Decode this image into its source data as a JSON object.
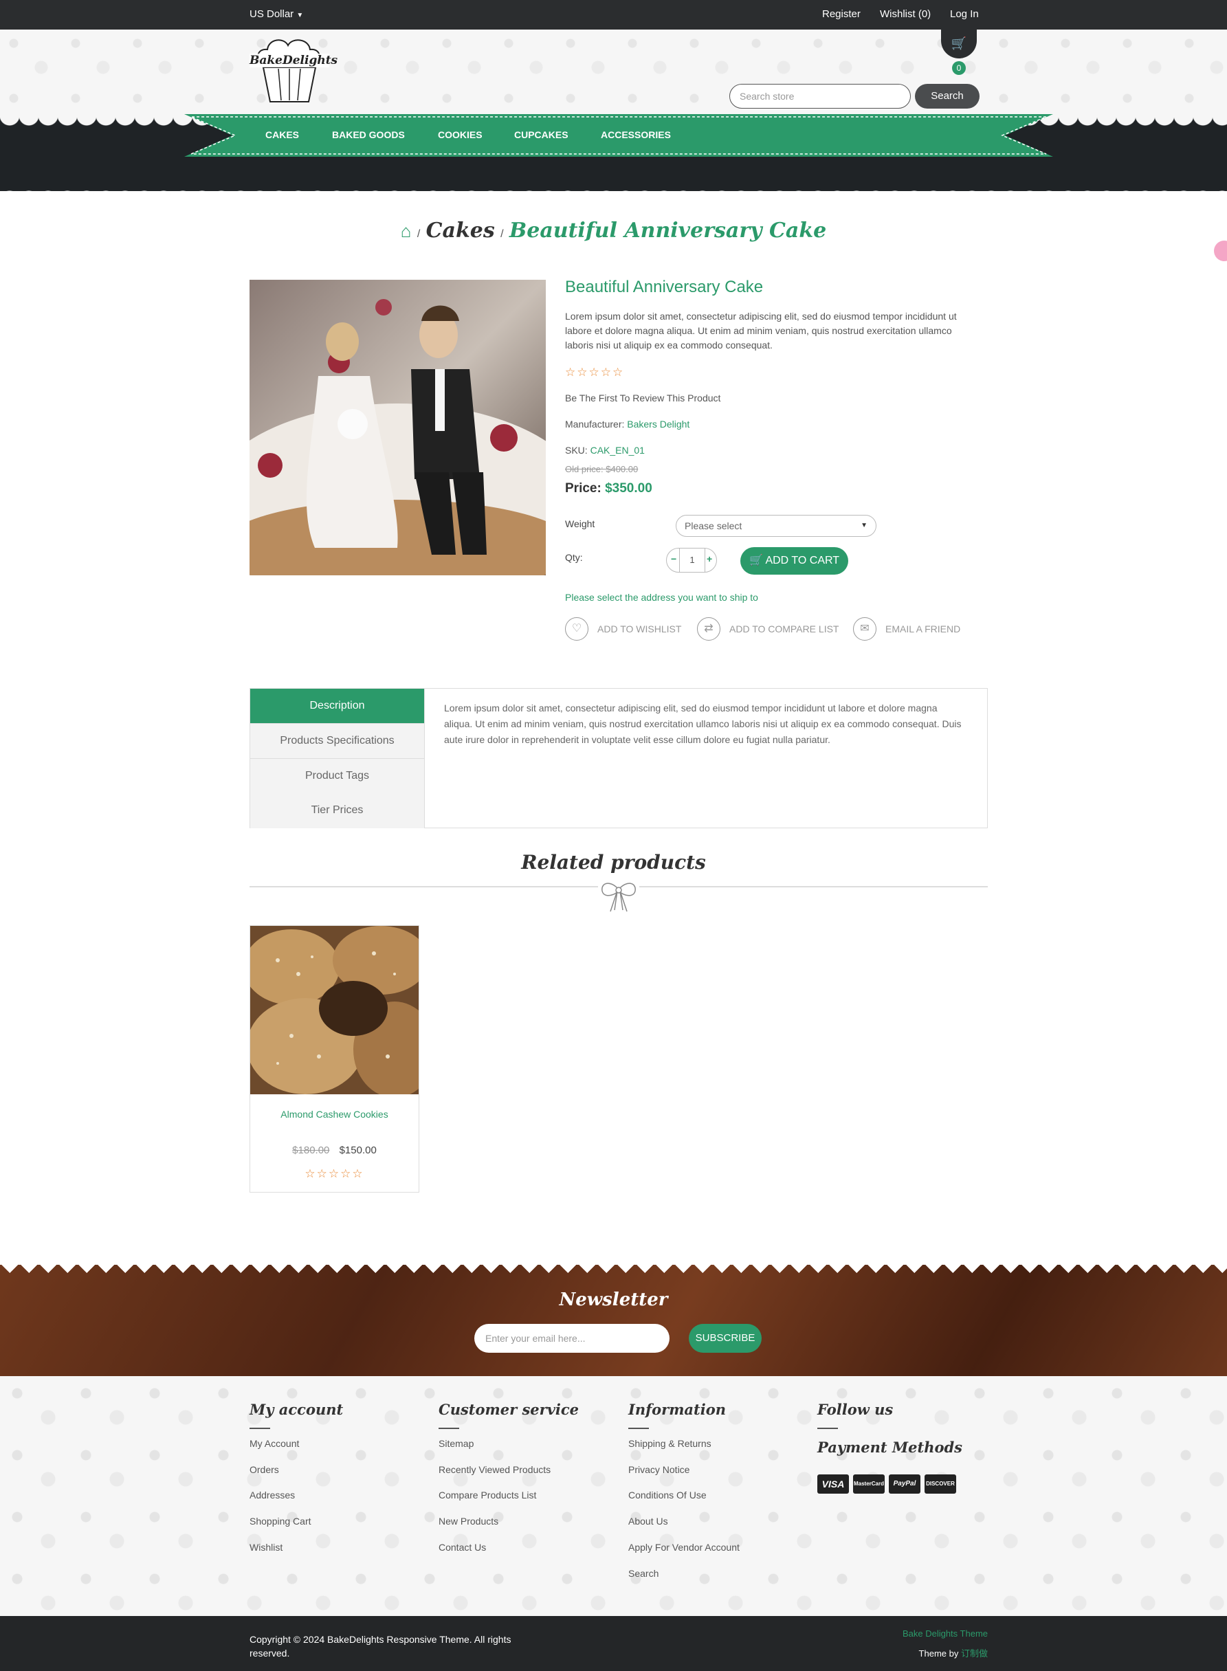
{
  "topbar": {
    "currency": "US Dollar",
    "register": "Register",
    "wishlist": "Wishlist (0)",
    "login": "Log In"
  },
  "header": {
    "logo_text": "BakeDelights",
    "cart_count": "0",
    "search_placeholder": "Search store",
    "search_button": "Search"
  },
  "nav": {
    "items": [
      "CAKES",
      "BAKED GOODS",
      "COOKIES",
      "CUPCAKES",
      "ACCESSORIES"
    ]
  },
  "breadcrumb": {
    "category": "Cakes",
    "current": "Beautiful Anniversary Cake",
    "sep": "/"
  },
  "product": {
    "title": "Beautiful Anniversary Cake",
    "short_description": "Lorem ipsum dolor sit amet, consectetur adipiscing elit, sed do eiusmod tempor incididunt ut labore et dolore magna aliqua. Ut enim ad minim veniam, quis nostrud exercitation ullamco laboris nisi ut aliquip ex ea commodo consequat.",
    "stars": "☆☆☆☆☆",
    "review_prompt": "Be The First To Review This Product",
    "manufacturer_label": "Manufacturer:",
    "manufacturer": "Bakers Delight",
    "sku_label": "SKU:",
    "sku": "CAK_EN_01",
    "old_price": "Old price: $400.00",
    "price_label": "Price:",
    "price": "$350.00",
    "weight_label": "Weight",
    "weight_select": "Please select",
    "qty_label": "Qty:",
    "qty": "1",
    "add_to_cart": "ADD TO CART",
    "ship_prompt": "Please select the address you want to ship to",
    "add_to_wishlist": "ADD TO WISHLIST",
    "add_to_compare": "ADD TO COMPARE LIST",
    "email_friend": "EMAIL A FRIEND"
  },
  "tabs": {
    "items": [
      "Description",
      "Products Specifications",
      "Product Tags",
      "Tier Prices"
    ],
    "content": "Lorem ipsum dolor sit amet, consectetur adipiscing elit, sed do eiusmod tempor incididunt ut labore et dolore magna aliqua. Ut enim ad minim veniam, quis nostrud exercitation ullamco laboris nisi ut aliquip ex ea commodo consequat. Duis aute irure dolor in reprehenderit in voluptate velit esse cillum dolore eu fugiat nulla pariatur."
  },
  "related": {
    "heading": "Related products",
    "product": {
      "name": "Almond Cashew Cookies",
      "old_price": "$180.00",
      "price": "$150.00",
      "stars": "☆☆☆☆☆"
    }
  },
  "newsletter": {
    "heading": "Newsletter",
    "placeholder": "Enter your email here...",
    "button": "SUBSCRIBE"
  },
  "footer": {
    "columns": [
      {
        "title": "My account",
        "links": [
          "My Account",
          "Orders",
          "Addresses",
          "Shopping Cart",
          "Wishlist"
        ]
      },
      {
        "title": "Customer service",
        "links": [
          "Sitemap",
          "Recently Viewed Products",
          "Compare Products List",
          "New Products",
          "Contact Us"
        ]
      },
      {
        "title": "Information",
        "links": [
          "Shipping & Returns",
          "Privacy Notice",
          "Conditions Of Use",
          "About Us",
          "Apply For Vendor Account",
          "Search"
        ]
      }
    ],
    "follow_title": "Follow us",
    "payment_title": "Payment Methods",
    "payments": [
      "VISA",
      "MasterCard",
      "PayPal",
      "DISCOVER"
    ],
    "copyright": "Copyright © 2024 BakeDelights Responsive Theme. All rights reserved.",
    "theme_name": "Bake Delights Theme",
    "theme_by": "Theme by",
    "theme_author": "订制做"
  },
  "colors": {
    "accent": "#2b9a6a",
    "dark": "#2b2d2f",
    "star": "#e98c3a"
  }
}
